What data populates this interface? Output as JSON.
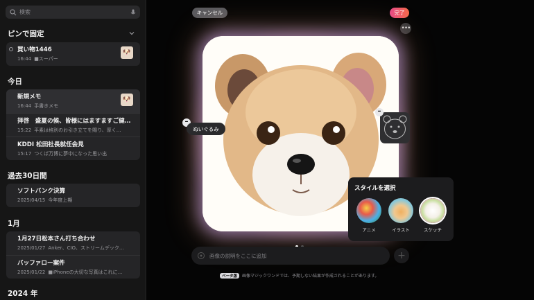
{
  "sidebar": {
    "search_placeholder": "検索",
    "pinned": {
      "title": "ピンで固定",
      "notes": [
        {
          "title": "買い物1446",
          "time": "16:44",
          "preview": "■スーパー"
        }
      ]
    },
    "today": {
      "title": "今日",
      "notes": [
        {
          "title": "新規メモ",
          "time": "16:44",
          "preview": "手書きメモ"
        },
        {
          "title": "拝啓　盛夏の候、皆様にはますますご健…",
          "time": "15:22",
          "preview": "平素は格別のお引き立てを賜り、厚く…"
        },
        {
          "title": "KDDI 松田社長就任会見",
          "time": "15:17",
          "preview": "つくば万博に夢中になった思い出"
        }
      ]
    },
    "past30": {
      "title": "過去30日間",
      "notes": [
        {
          "title": "ソフトバンク決算",
          "time": "2025/04/15",
          "preview": "今年度上期"
        }
      ]
    },
    "january": {
      "title": "1月",
      "notes": [
        {
          "title": "1月27日松本さん打ち合わせ",
          "time": "2025/01/27",
          "preview": "Anker、CIO、ストリームデック…"
        },
        {
          "title": "バッファロー案件",
          "time": "2025/01/22",
          "preview": "■iPhoneの大切な写真はこれに…"
        }
      ]
    },
    "year2024": {
      "title": "2024 年"
    }
  },
  "editor": {
    "cancel_label": "キャンセル",
    "done_label": "完了",
    "more_icon": "ellipsis-icon",
    "concept_chip": "ぬいぐるみ",
    "remove_symbol": "–",
    "style_panel": {
      "title": "スタイルを選択",
      "options": [
        {
          "label": "アニメ",
          "selected": false
        },
        {
          "label": "イラスト",
          "selected": false
        },
        {
          "label": "スケッチ",
          "selected": true
        }
      ]
    },
    "page_indicator": {
      "count": 2,
      "current": 1
    },
    "prompt_placeholder": "画像の説明をここに追加",
    "add_symbol": "+",
    "beta_badge": "ベータ版",
    "footer_text": "画像マジックワンドでは、予期しない結果が作成されることがあります。"
  },
  "colors": {
    "accent_done": "#e84a8a",
    "background": "#050505",
    "sidebar": "#161616"
  }
}
